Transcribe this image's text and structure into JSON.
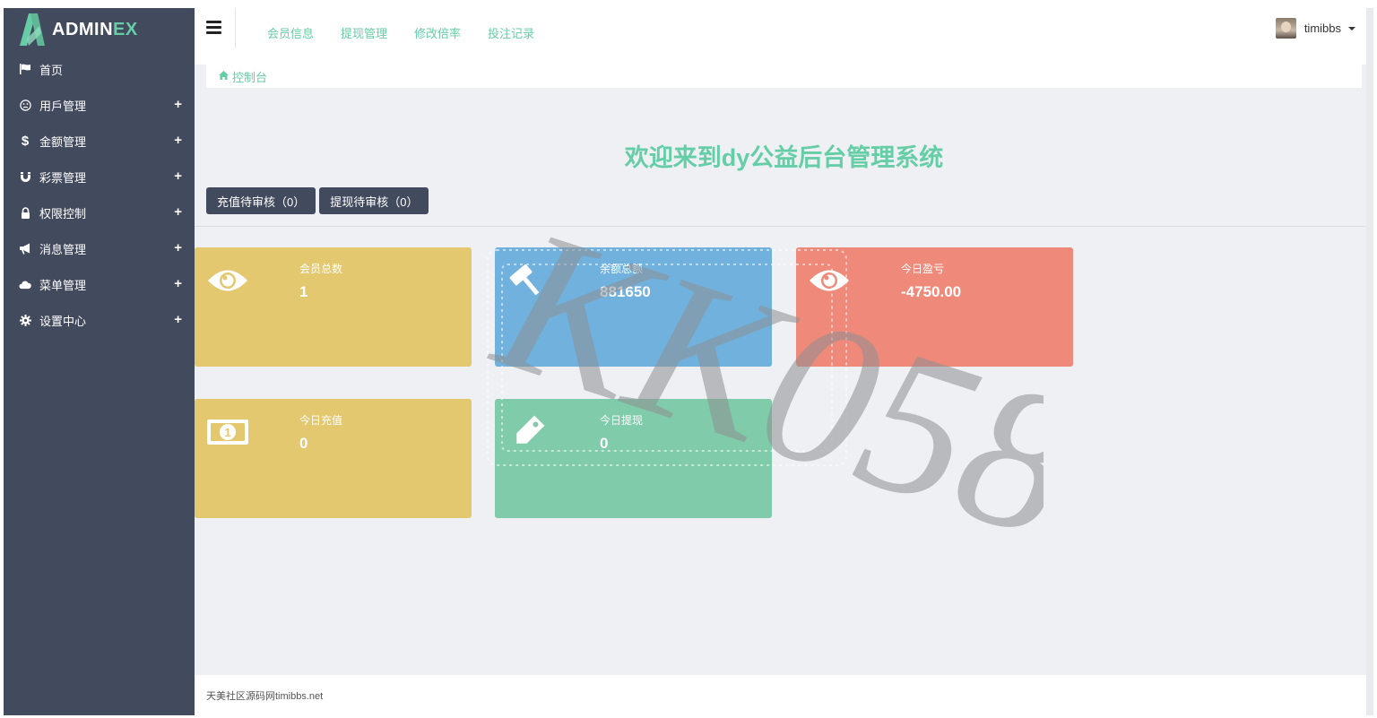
{
  "brand": {
    "text_main": "ADMIN",
    "text_accent": "EX"
  },
  "sidebar": {
    "items": [
      {
        "label": "首页",
        "icon": "flag-icon",
        "expandable": false
      },
      {
        "label": "用戶管理",
        "icon": "smile-icon",
        "expandable": true
      },
      {
        "label": "金额管理",
        "icon": "dollar-icon",
        "expandable": true
      },
      {
        "label": "彩票管理",
        "icon": "magnet-icon",
        "expandable": true
      },
      {
        "label": "权限控制",
        "icon": "lock-icon",
        "expandable": true
      },
      {
        "label": "消息管理",
        "icon": "bullhorn-icon",
        "expandable": true
      },
      {
        "label": "菜单管理",
        "icon": "cloud-icon",
        "expandable": true
      },
      {
        "label": "设置中心",
        "icon": "gear-icon",
        "expandable": true
      }
    ],
    "expand_symbol": "+"
  },
  "header": {
    "menu": [
      "会员信息",
      "提现管理",
      "修改倍率",
      "投注记录"
    ],
    "user_name": "timibbs"
  },
  "breadcrumb": {
    "label": "控制台"
  },
  "main": {
    "welcome": "欢迎来到dy公益后台管理系统",
    "buttons": {
      "recharge_pending": "充值待审核（0）",
      "withdraw_pending": "提现待审核（0）"
    }
  },
  "cards": [
    {
      "label": "会员总数",
      "value": "1",
      "icon": "eye-icon",
      "color": "#e3c86f"
    },
    {
      "label": "余额总额",
      "value": "881650",
      "icon": "gavel-icon",
      "color": "#71b1dd"
    },
    {
      "label": "今日盈亏",
      "value": "-4750.00",
      "icon": "eye-icon",
      "color": "#ef8a7a"
    },
    {
      "label": "今日充值",
      "value": "0",
      "icon": "money-icon",
      "color": "#e3c86f"
    },
    {
      "label": "今日提现",
      "value": "0",
      "icon": "tag-icon",
      "color": "#80ccaa"
    }
  ],
  "footer": {
    "text": "天美社区源码网timibbs.net"
  },
  "watermark": {
    "text": "KK058"
  },
  "colors": {
    "sidebar": "#424a5d",
    "accent": "#65cea7",
    "background": "#eff0f4"
  }
}
